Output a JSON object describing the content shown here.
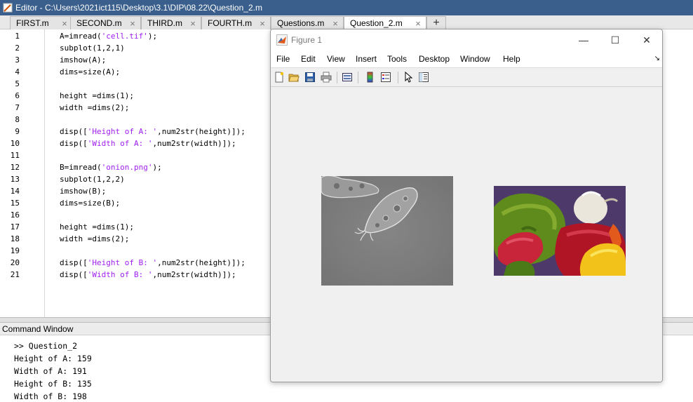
{
  "window": {
    "title": "Editor - C:\\Users\\2021ict115\\Desktop\\3.1\\DIP\\08.22\\Question_2.m"
  },
  "tabs": [
    {
      "label": "FIRST.m",
      "active": false
    },
    {
      "label": "SECOND.m",
      "active": false
    },
    {
      "label": "THIRD.m",
      "active": false
    },
    {
      "label": "FOURTH.m",
      "active": false
    },
    {
      "label": "Questions.m",
      "active": false
    },
    {
      "label": "Question_2.m",
      "active": true
    }
  ],
  "tab_add_label": "+",
  "tab_close_glyph": "×",
  "editor": {
    "line_numbers": [
      "1",
      "2",
      "3",
      "4",
      "5",
      "6",
      "7",
      "8",
      "9",
      "10",
      "11",
      "12",
      "13",
      "14",
      "15",
      "16",
      "17",
      "18",
      "19",
      "20",
      "21"
    ],
    "lines": [
      {
        "pre": "A=imread(",
        "str": "'cell.tif'",
        "post": ");"
      },
      {
        "pre": "subplot(1,2,1)",
        "str": "",
        "post": ""
      },
      {
        "pre": "imshow(A);",
        "str": "",
        "post": ""
      },
      {
        "pre": "dims=size(A);",
        "str": "",
        "post": ""
      },
      {
        "pre": "",
        "str": "",
        "post": ""
      },
      {
        "pre": "height =dims(1);",
        "str": "",
        "post": ""
      },
      {
        "pre": "width =dims(2);",
        "str": "",
        "post": ""
      },
      {
        "pre": "",
        "str": "",
        "post": ""
      },
      {
        "pre": "disp([",
        "str": "'Height of A: '",
        "post": ",num2str(height)]);"
      },
      {
        "pre": "disp([",
        "str": "'Width of A: '",
        "post": ",num2str(width)]);"
      },
      {
        "pre": "",
        "str": "",
        "post": ""
      },
      {
        "pre": "B=imread(",
        "str": "'onion.png'",
        "post": ");"
      },
      {
        "pre": "subplot(1,2,2)",
        "str": "",
        "post": ""
      },
      {
        "pre": "imshow(B);",
        "str": "",
        "post": ""
      },
      {
        "pre": "dims=size(B);",
        "str": "",
        "post": ""
      },
      {
        "pre": "",
        "str": "",
        "post": ""
      },
      {
        "pre": "height =dims(1);",
        "str": "",
        "post": ""
      },
      {
        "pre": "width =dims(2);",
        "str": "",
        "post": ""
      },
      {
        "pre": "",
        "str": "",
        "post": ""
      },
      {
        "pre": "disp([",
        "str": "'Height of B: '",
        "post": ",num2str(height)]);"
      },
      {
        "pre": "disp([",
        "str": "'Width of B: '",
        "post": ",num2str(width)]);"
      }
    ]
  },
  "command_window": {
    "title": "Command Window",
    "lines": [
      ">> Question_2",
      "Height of A: 159",
      "Width of A: 191",
      "Height of B: 135",
      "Width of B: 198"
    ]
  },
  "figure": {
    "title": "Figure 1",
    "minimize_glyph": "—",
    "maximize_glyph": "☐",
    "close_glyph": "✕",
    "menu": [
      "File",
      "Edit",
      "View",
      "Insert",
      "Tools",
      "Desktop",
      "Window",
      "Help"
    ],
    "menu_arrow_glyph": "↘",
    "toolbar": [
      "new-figure-icon",
      "open-file-icon",
      "save-icon",
      "print-icon",
      "link-plot-icon",
      "colorbar-icon",
      "legend-icon",
      "edit-plot-icon",
      "property-inspector-icon"
    ]
  },
  "colors": {
    "titlebar": "#3a5f8c",
    "string": "#a020f0"
  }
}
